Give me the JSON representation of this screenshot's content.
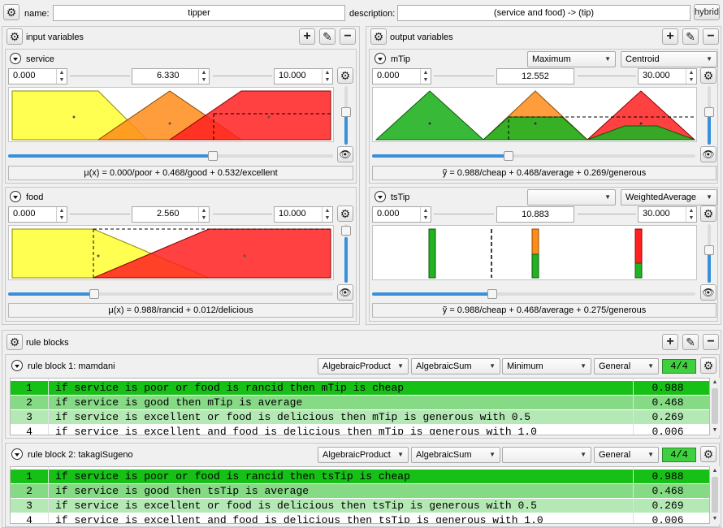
{
  "header": {
    "name_label": "name:",
    "name_value": "tipper",
    "description_label": "description:",
    "description_value": "(service and food) -> (tip)",
    "hybrid_label": "hybrid"
  },
  "inputs": {
    "title": "input variables",
    "variables": [
      {
        "name": "service",
        "min": "0.000",
        "value": "6.330",
        "max": "10.000",
        "formula": "μ(x) = 0.000/poor + 0.468/good + 0.532/excellent"
      },
      {
        "name": "food",
        "min": "0.000",
        "value": "2.560",
        "max": "10.000",
        "formula": "μ(x) = 0.988/rancid + 0.012/delicious"
      }
    ]
  },
  "outputs": {
    "title": "output variables",
    "variables": [
      {
        "name": "mTip",
        "aggregation": "Maximum",
        "defuzzifier": "Centroid",
        "min": "0.000",
        "value": "12.552",
        "max": "30.000",
        "formula": "ỹ = 0.988/cheap + 0.468/average + 0.269/generous"
      },
      {
        "name": "tsTip",
        "aggregation": "",
        "defuzzifier": "WeightedAverage",
        "min": "0.000",
        "value": "10.883",
        "max": "30.000",
        "formula": "ỹ = 0.988/cheap + 0.468/average + 0.275/generous"
      }
    ]
  },
  "rule_blocks": {
    "title": "rule blocks",
    "blocks": [
      {
        "name": "rule block 1: mamdani",
        "conjunction": "AlgebraicProduct",
        "disjunction": "AlgebraicSum",
        "implication": "Minimum",
        "activation": "General",
        "count": "4/4",
        "rules": [
          {
            "n": "1",
            "text": "if service is poor or food is rancid then mTip is cheap",
            "weight": "0.988"
          },
          {
            "n": "2",
            "text": "if service is good then mTip is average",
            "weight": "0.468"
          },
          {
            "n": "3",
            "text": "if service is excellent or food is delicious then mTip is generous with 0.5",
            "weight": "0.269"
          },
          {
            "n": "4",
            "text": "if service is excellent and food is delicious then mTip is generous with 1.0",
            "weight": "0.006"
          }
        ]
      },
      {
        "name": "rule block 2: takagiSugeno",
        "conjunction": "AlgebraicProduct",
        "disjunction": "AlgebraicSum",
        "implication": "",
        "activation": "General",
        "count": "4/4",
        "rules": [
          {
            "n": "1",
            "text": "if service is poor or food is rancid then tsTip is cheap",
            "weight": "0.988"
          },
          {
            "n": "2",
            "text": "if service is good then tsTip is average",
            "weight": "0.468"
          },
          {
            "n": "3",
            "text": "if service is excellent or food is delicious then tsTip is generous with 0.5",
            "weight": "0.269"
          },
          {
            "n": "4",
            "text": "if service is excellent and food is delicious then tsTip is generous with 1.0",
            "weight": "0.006"
          }
        ]
      }
    ]
  },
  "icons": {
    "settings": "gear-icon",
    "add": "plus-icon",
    "edit": "pencil-icon",
    "remove": "minus-icon",
    "collapse": "chevron-down-circle-icon",
    "visibility": "eye-icon"
  },
  "colors": {
    "term_low": "#ffff33",
    "term_mid": "#ff8c1a",
    "term_high": "#ff2020",
    "output_cheap": "#22b222",
    "rule_active": "#16c016",
    "rule_mid": "#86da86",
    "rule_low": "#b4e8b4",
    "slider": "#3a8fdb"
  }
}
